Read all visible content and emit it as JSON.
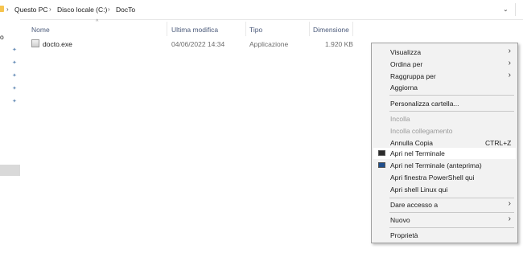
{
  "breadcrumb": [
    "Questo PC",
    "Disco locale (C:)",
    "DocTo"
  ],
  "nav": {
    "fragment": "o"
  },
  "columns": [
    "Nome",
    "Ultima modifica",
    "Tipo",
    "Dimensione"
  ],
  "files": [
    {
      "name": "docto.exe",
      "modified": "04/06/2022 14:34",
      "type": "Applicazione",
      "size": "1.920 KB"
    }
  ],
  "context_menu": {
    "items": [
      {
        "label": "Visualizza",
        "submenu": true
      },
      {
        "label": "Ordina per",
        "submenu": true
      },
      {
        "label": "Raggruppa per",
        "submenu": true
      },
      {
        "label": "Aggiorna"
      },
      {
        "label": "Personalizza cartella..."
      },
      {
        "label": "Incolla",
        "disabled": true
      },
      {
        "label": "Incolla collegamento",
        "disabled": true
      },
      {
        "label": "Annulla Copia",
        "shortcut": "CTRL+Z"
      },
      {
        "label": "Apri nel Terminale",
        "icon": "terminal-icon",
        "highlighted": true
      },
      {
        "label": "Apri nel Terminale (anteprima)",
        "icon": "terminal-preview-icon"
      },
      {
        "label": "Apri finestra PowerShell qui"
      },
      {
        "label": "Apri shell Linux qui"
      },
      {
        "label": "Dare accesso a",
        "submenu": true
      },
      {
        "label": "Nuovo",
        "submenu": true
      },
      {
        "label": "Proprietà"
      }
    ]
  },
  "icons": {
    "submenu_arrow": "›",
    "chevron_right": "›",
    "chevron_down": "⌄",
    "sort_up": "^",
    "pin": "📌"
  },
  "colors": {
    "menu_background": "#f2f2f2",
    "menu_highlight": "#ffffff",
    "disabled_text": "#9a9a9a",
    "column_header_text": "#4b5a7a",
    "folder_yellow": "#f6c44f"
  }
}
